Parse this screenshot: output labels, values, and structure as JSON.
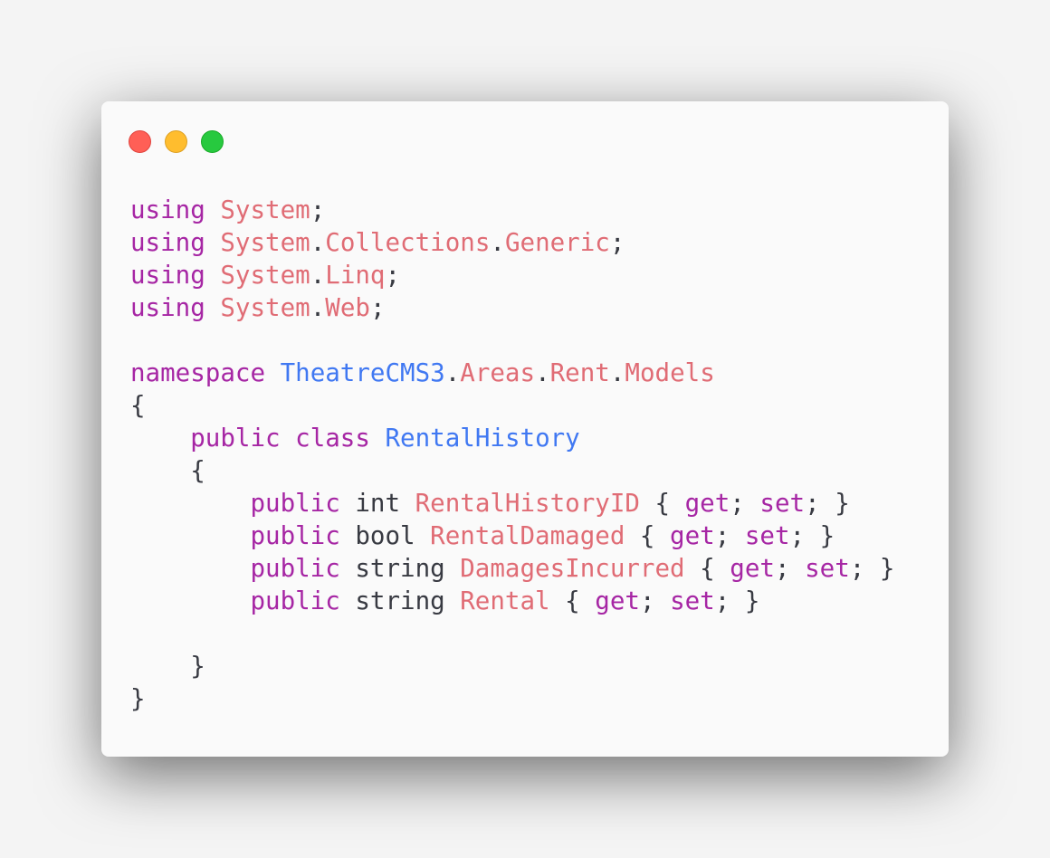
{
  "window": {
    "traffic_lights": [
      "close",
      "minimize",
      "maximize"
    ]
  },
  "colors": {
    "keyword": "#a626a4",
    "type": "#e06c75",
    "class": "#4078f2",
    "plain": "#383a42",
    "background": "#fafafa",
    "page_background": "#f4f4f4"
  },
  "code": {
    "lines": [
      [
        {
          "t": "using",
          "c": "kw"
        },
        {
          "t": " ",
          "c": "pl"
        },
        {
          "t": "System",
          "c": "ty"
        },
        {
          "t": ";",
          "c": "pl"
        }
      ],
      [
        {
          "t": "using",
          "c": "kw"
        },
        {
          "t": " ",
          "c": "pl"
        },
        {
          "t": "System",
          "c": "ty"
        },
        {
          "t": ".",
          "c": "pl"
        },
        {
          "t": "Collections",
          "c": "ty"
        },
        {
          "t": ".",
          "c": "pl"
        },
        {
          "t": "Generic",
          "c": "ty"
        },
        {
          "t": ";",
          "c": "pl"
        }
      ],
      [
        {
          "t": "using",
          "c": "kw"
        },
        {
          "t": " ",
          "c": "pl"
        },
        {
          "t": "System",
          "c": "ty"
        },
        {
          "t": ".",
          "c": "pl"
        },
        {
          "t": "Linq",
          "c": "ty"
        },
        {
          "t": ";",
          "c": "pl"
        }
      ],
      [
        {
          "t": "using",
          "c": "kw"
        },
        {
          "t": " ",
          "c": "pl"
        },
        {
          "t": "System",
          "c": "ty"
        },
        {
          "t": ".",
          "c": "pl"
        },
        {
          "t": "Web",
          "c": "ty"
        },
        {
          "t": ";",
          "c": "pl"
        }
      ],
      [],
      [
        {
          "t": "namespace",
          "c": "kw"
        },
        {
          "t": " ",
          "c": "pl"
        },
        {
          "t": "TheatreCMS3",
          "c": "cls"
        },
        {
          "t": ".",
          "c": "pl"
        },
        {
          "t": "Areas",
          "c": "ty"
        },
        {
          "t": ".",
          "c": "pl"
        },
        {
          "t": "Rent",
          "c": "ty"
        },
        {
          "t": ".",
          "c": "pl"
        },
        {
          "t": "Models",
          "c": "ty"
        }
      ],
      [
        {
          "t": "{",
          "c": "pl"
        }
      ],
      [
        {
          "t": "    ",
          "c": "pl"
        },
        {
          "t": "public",
          "c": "kw"
        },
        {
          "t": " ",
          "c": "pl"
        },
        {
          "t": "class",
          "c": "kw"
        },
        {
          "t": " ",
          "c": "pl"
        },
        {
          "t": "RentalHistory",
          "c": "cls"
        }
      ],
      [
        {
          "t": "    {",
          "c": "pl"
        }
      ],
      [
        {
          "t": "        ",
          "c": "pl"
        },
        {
          "t": "public",
          "c": "kw"
        },
        {
          "t": " int ",
          "c": "pl"
        },
        {
          "t": "RentalHistoryID",
          "c": "ty"
        },
        {
          "t": " { ",
          "c": "pl"
        },
        {
          "t": "get",
          "c": "kw"
        },
        {
          "t": "; ",
          "c": "pl"
        },
        {
          "t": "set",
          "c": "kw"
        },
        {
          "t": "; }",
          "c": "pl"
        }
      ],
      [
        {
          "t": "        ",
          "c": "pl"
        },
        {
          "t": "public",
          "c": "kw"
        },
        {
          "t": " bool ",
          "c": "pl"
        },
        {
          "t": "RentalDamaged",
          "c": "ty"
        },
        {
          "t": " { ",
          "c": "pl"
        },
        {
          "t": "get",
          "c": "kw"
        },
        {
          "t": "; ",
          "c": "pl"
        },
        {
          "t": "set",
          "c": "kw"
        },
        {
          "t": "; }",
          "c": "pl"
        }
      ],
      [
        {
          "t": "        ",
          "c": "pl"
        },
        {
          "t": "public",
          "c": "kw"
        },
        {
          "t": " string ",
          "c": "pl"
        },
        {
          "t": "DamagesIncurred",
          "c": "ty"
        },
        {
          "t": " { ",
          "c": "pl"
        },
        {
          "t": "get",
          "c": "kw"
        },
        {
          "t": "; ",
          "c": "pl"
        },
        {
          "t": "set",
          "c": "kw"
        },
        {
          "t": "; }",
          "c": "pl"
        }
      ],
      [
        {
          "t": "        ",
          "c": "pl"
        },
        {
          "t": "public",
          "c": "kw"
        },
        {
          "t": " string ",
          "c": "pl"
        },
        {
          "t": "Rental",
          "c": "ty"
        },
        {
          "t": " { ",
          "c": "pl"
        },
        {
          "t": "get",
          "c": "kw"
        },
        {
          "t": "; ",
          "c": "pl"
        },
        {
          "t": "set",
          "c": "kw"
        },
        {
          "t": "; }",
          "c": "pl"
        }
      ],
      [],
      [
        {
          "t": "    }",
          "c": "pl"
        }
      ],
      [
        {
          "t": "}",
          "c": "pl"
        }
      ]
    ]
  }
}
